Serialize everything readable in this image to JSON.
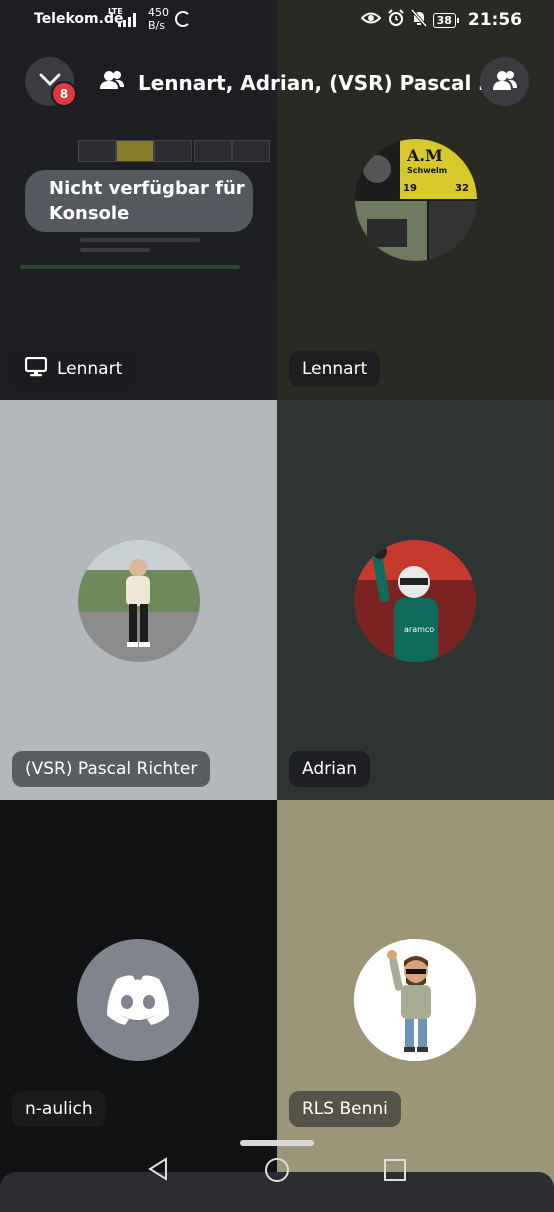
{
  "status_bar": {
    "carrier": "Telekom.de",
    "network": "LTE",
    "speed_value": "450",
    "speed_unit": "B/s",
    "battery": "38",
    "time": "21:56"
  },
  "header": {
    "title": "Lennart, Adrian, (VSR) Pascal …",
    "badge_count": "8",
    "icons": {
      "collapse": "chevron-down-icon",
      "group": "people-icon",
      "members": "people-icon"
    }
  },
  "tiles": [
    {
      "name": "Lennart",
      "kind": "screen-share",
      "notice": "Nicht verfügbar für Konsole",
      "icon": "monitor-icon",
      "bg": "#1d1e22"
    },
    {
      "name": "Lennart",
      "kind": "avatar",
      "bg": "#2a2a24"
    },
    {
      "name": "(VSR) Pascal Richter",
      "kind": "avatar",
      "bg": "#b2b8bb"
    },
    {
      "name": "Adrian",
      "kind": "avatar",
      "bg": "#2e3431"
    },
    {
      "name": "n-aulich",
      "kind": "avatar",
      "icon": "discord-logo-icon",
      "bg": "#111214"
    },
    {
      "name": "RLS Benni",
      "kind": "avatar",
      "bg": "#9d9577"
    }
  ],
  "nav": {
    "back": "back-triangle-icon",
    "home": "home-circle-icon",
    "recents": "recents-square-icon"
  },
  "colors": {
    "badge": "#e2373d",
    "discord_avatar": "#80848e"
  }
}
